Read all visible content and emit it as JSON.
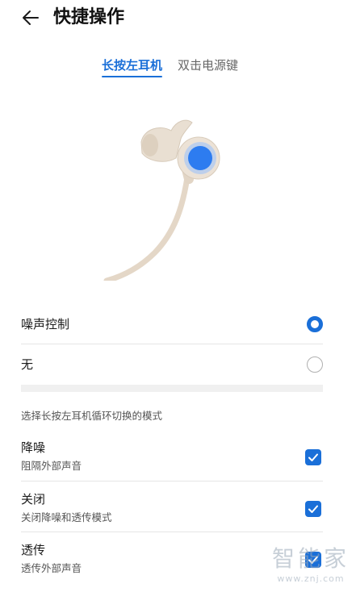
{
  "header": {
    "title": "快捷操作",
    "back_icon": "arrow-left-icon"
  },
  "tabs": [
    {
      "label": "长按左耳机",
      "active": true
    },
    {
      "label": "双击电源键",
      "active": false
    }
  ],
  "colors": {
    "accent": "#1a6fd8",
    "earphone_body": "#e8ddd0",
    "button_highlight": "#2d7cf0"
  },
  "mode_options": [
    {
      "label": "噪声控制",
      "selected": true
    },
    {
      "label": "无",
      "selected": false
    }
  ],
  "cycle_section": {
    "caption": "选择长按左耳机循环切换的模式",
    "items": [
      {
        "title": "降噪",
        "subtitle": "阻隔外部声音",
        "checked": true
      },
      {
        "title": "关闭",
        "subtitle": "关闭降噪和透传模式",
        "checked": true
      },
      {
        "title": "透传",
        "subtitle": "透传外部声音",
        "checked": true
      }
    ]
  },
  "watermark": {
    "text": "智能家",
    "url": "www.znj.com"
  }
}
